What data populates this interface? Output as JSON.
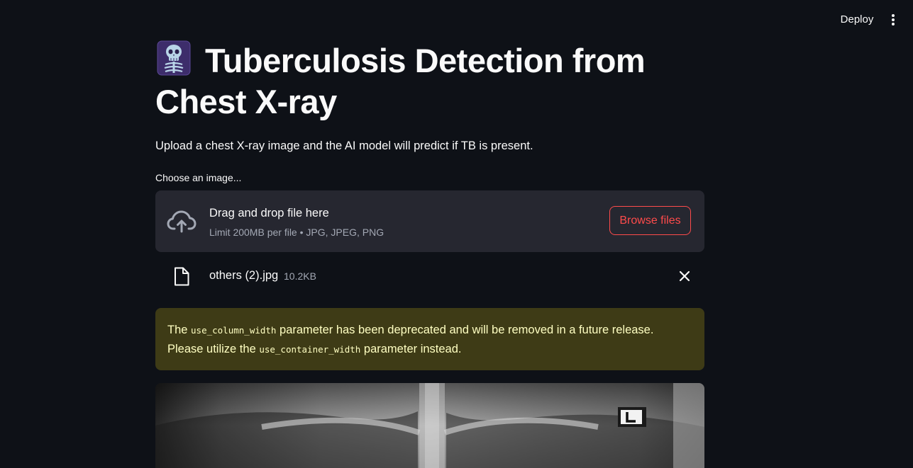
{
  "header": {
    "deploy_label": "Deploy"
  },
  "page": {
    "title_line1": "Tuberculosis Detection from",
    "title_line2": "Chest X-ray",
    "description": "Upload a chest X-ray image and the AI model will predict if TB is present.",
    "title_icon": "skeleton-xray-emoji"
  },
  "uploader": {
    "label": "Choose an image...",
    "dropzone_title": "Drag and drop file here",
    "dropzone_limit": "Limit 200MB per file • JPG, JPEG, PNG",
    "browse_label": "Browse files",
    "file": {
      "name": "others (2).jpg",
      "size": "10.2KB"
    }
  },
  "warning": {
    "part1": "The ",
    "code1": "use_column_width",
    "part2": " parameter has been deprecated and will be removed in a future release. Please utilize the ",
    "code2": "use_container_width",
    "part3": " parameter instead."
  },
  "colors": {
    "background": "#0e1117",
    "accent": "#ff4b4b",
    "dropzone": "#262730",
    "warning_bg": "#3e3b16",
    "warning_text": "#ffffc2"
  }
}
